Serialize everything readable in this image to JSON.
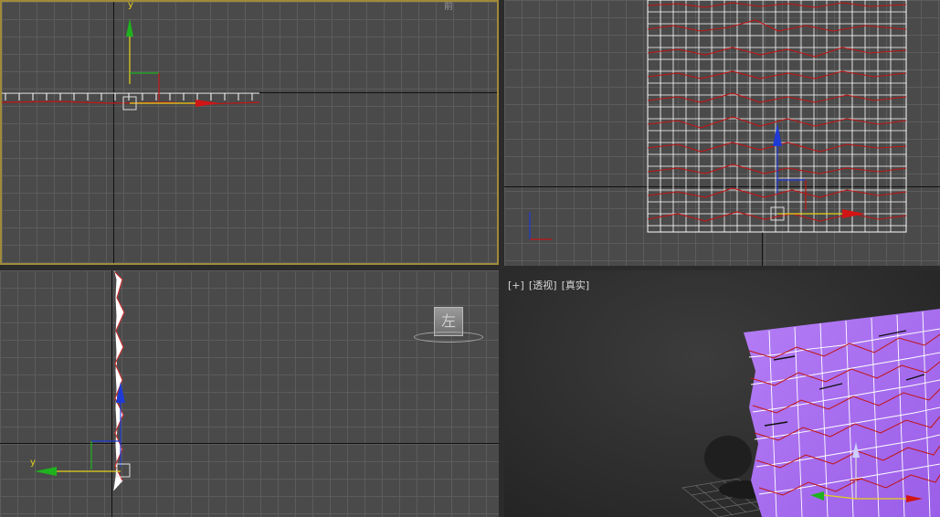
{
  "viewports": {
    "top": {
      "corner_label": "前",
      "axis_y_label": "y"
    },
    "front": {},
    "left": {
      "viewcube_face": "左",
      "axis_y_label": "y"
    },
    "perspective": {
      "menu_plus": "[+]",
      "menu_view": "[透视]",
      "menu_shading": "[真实]"
    }
  },
  "colors": {
    "active_border": "#a08a3a",
    "grid_bg": "#4a4a4a",
    "mesh_color": "#a96cf0",
    "axis_x": "#d21414",
    "axis_y": "#1fb21f",
    "axis_z": "#1e3bd6"
  }
}
